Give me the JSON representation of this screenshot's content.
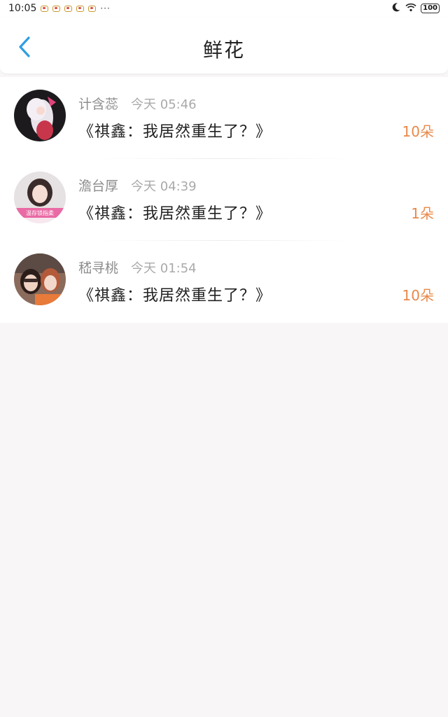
{
  "status_bar": {
    "time": "10:05",
    "dots": "···",
    "battery": "100"
  },
  "header": {
    "title": "鲜花"
  },
  "items": [
    {
      "name": "计含蕊",
      "time": "今天 05:46",
      "content": "《祺鑫：我居然重生了？》",
      "amount": "10朵"
    },
    {
      "name": "澹台厚",
      "time": "今天 04:39",
      "content": "《祺鑫：我居然重生了？》",
      "amount": "1朵",
      "avatar_caption": "温存锁指柔"
    },
    {
      "name": "嵇寻桃",
      "time": "今天 01:54",
      "content": "《祺鑫：我居然重生了？》",
      "amount": "10朵"
    }
  ],
  "colors": {
    "accent_back": "#2f9ee0",
    "amount": "#e8894a",
    "background": "#f8f6f6"
  }
}
